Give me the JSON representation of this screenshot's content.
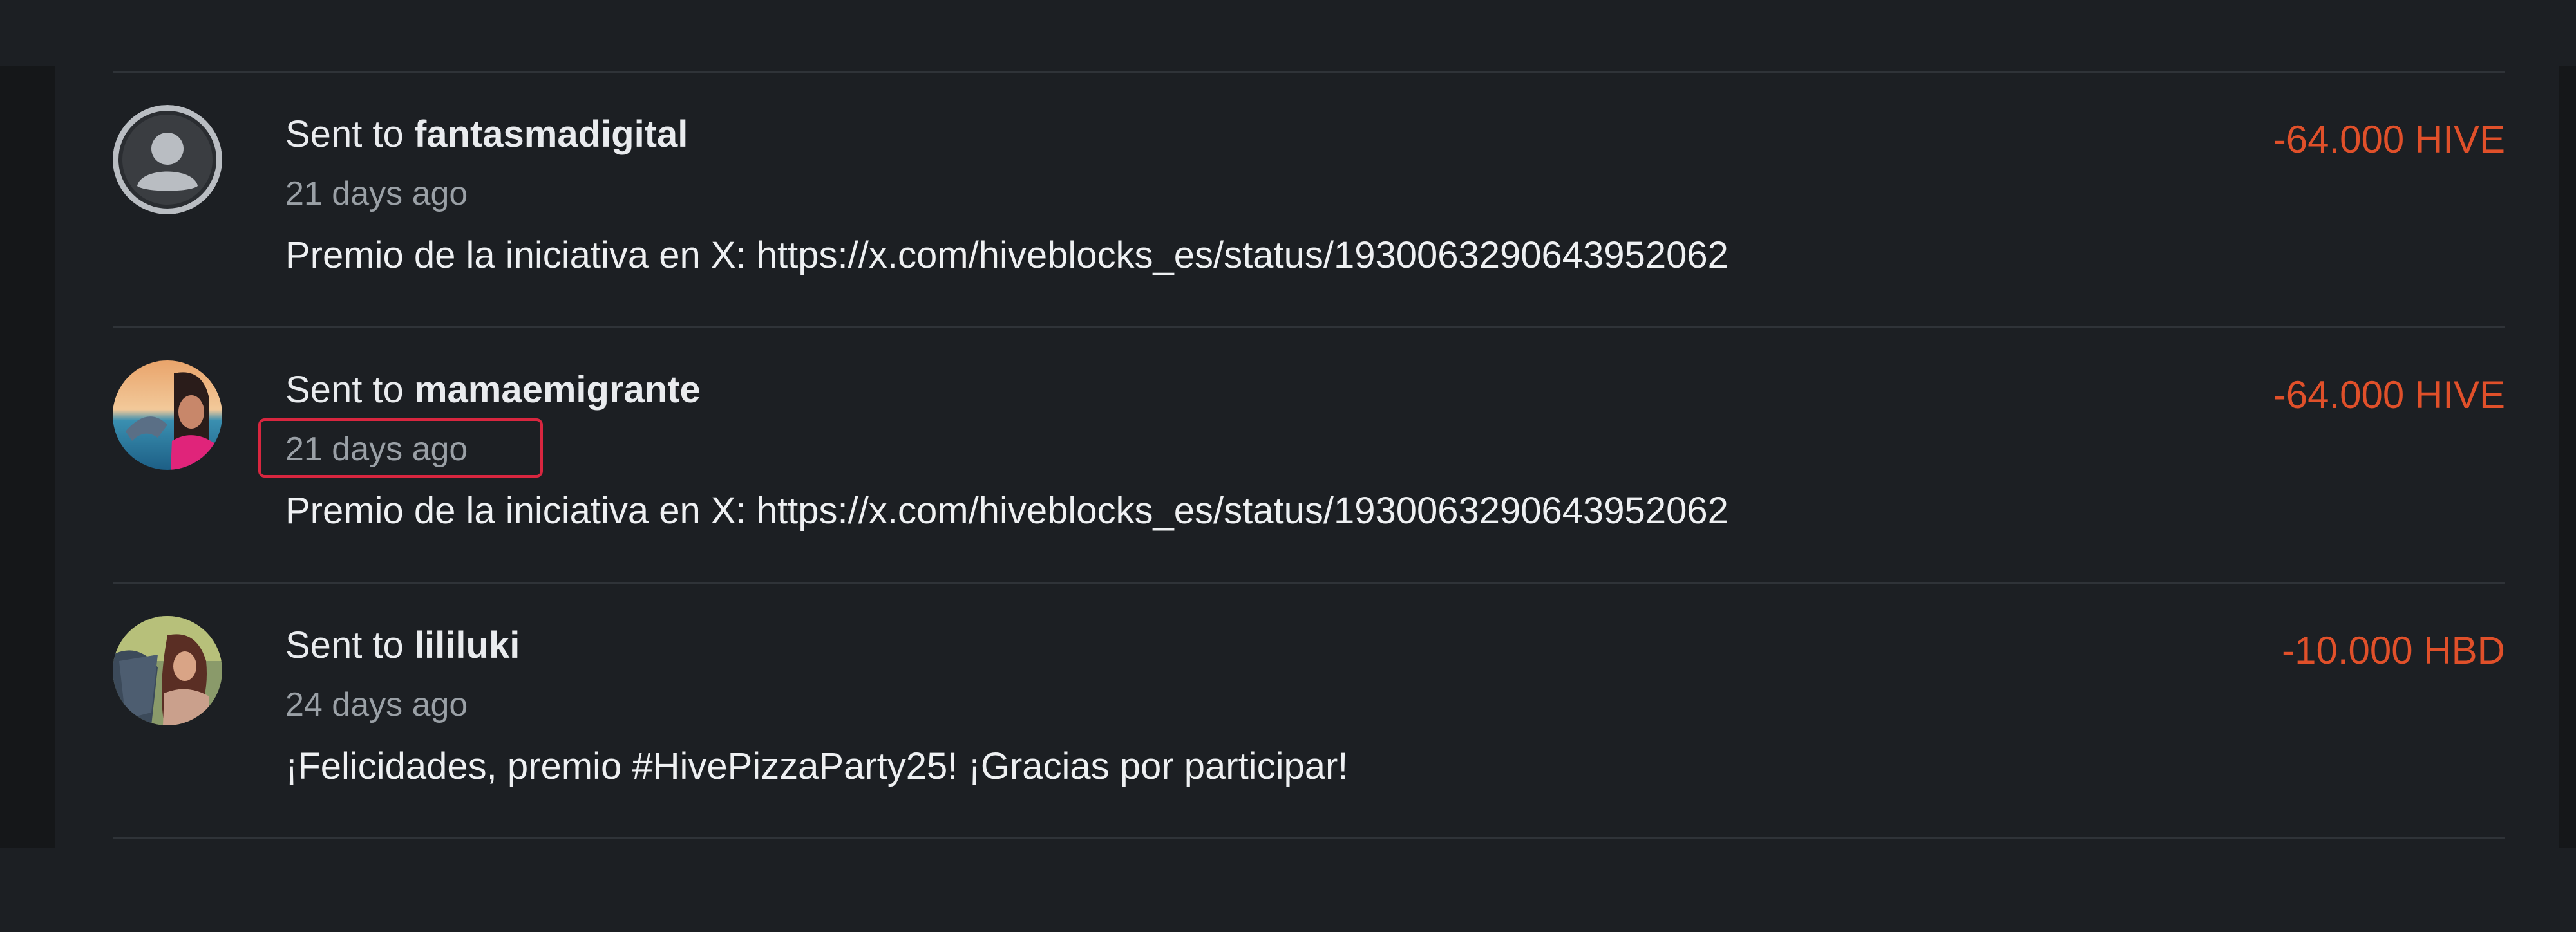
{
  "transactions": [
    {
      "prefix": "Sent to",
      "recipient": "fantasmadigital",
      "time": "21 days ago",
      "memo": "Premio de la iniciativa en X: https://x.com/hiveblocks_es/status/1930063290643952062",
      "amount": "-64.000 HIVE",
      "avatar": "default-user-icon"
    },
    {
      "prefix": "Sent to",
      "recipient": "mamaemigrante",
      "time": "21 days ago",
      "memo": "Premio de la iniciativa en X: https://x.com/hiveblocks_es/status/1930063290643952062",
      "amount": "-64.000 HIVE",
      "avatar": "user-photo"
    },
    {
      "prefix": "Sent to",
      "recipient": "lililuki",
      "time": "24 days ago",
      "memo": "¡Felicidades, premio #HivePizzaParty25! ¡Gracias por participar!",
      "amount": "-10.000 HBD",
      "avatar": "user-photo"
    }
  ],
  "colors": {
    "background": "#1c1f23",
    "amount": "#e0502a",
    "highlight_border": "#d8263f",
    "secondary_text": "#9aa0a6"
  }
}
